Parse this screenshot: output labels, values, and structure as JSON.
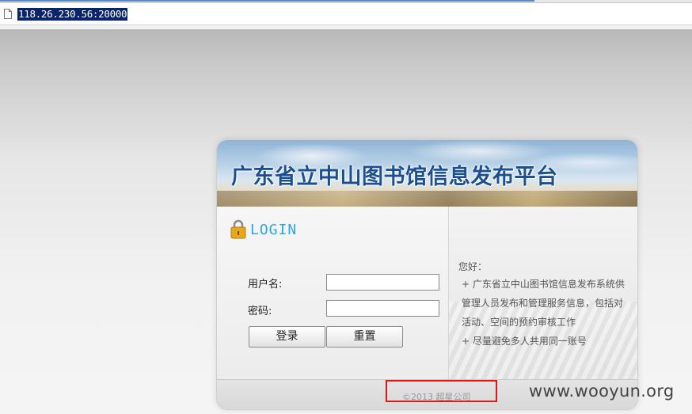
{
  "browser": {
    "url": "118.26.230.56:20000",
    "page_icon": "page-icon"
  },
  "banner": {
    "title": "广东省立中山图书馆信息发布平台"
  },
  "login": {
    "lock_icon": "lock-icon",
    "heading": "LOGIN",
    "username_label": "用户名:",
    "username_value": "",
    "password_label": "密码:",
    "password_value": "",
    "login_button": "登录",
    "reset_button": "重置"
  },
  "info": {
    "greeting": "您好：",
    "bullets": [
      "+ 广东省立中山图书馆信息发布系统供管理人员发布和管理服务信息，包括对活动、空间的预约审核工作",
      "+ 尽量避免多人共用同一账号"
    ]
  },
  "footer": {
    "copyright": "©2013   超星公司"
  },
  "watermark": "www.wooyun.org",
  "colors": {
    "title": "#1b4f8f",
    "login_heading": "#2aa7d8",
    "highlight_box": "#e01818",
    "url_selection": "#0a246a"
  }
}
